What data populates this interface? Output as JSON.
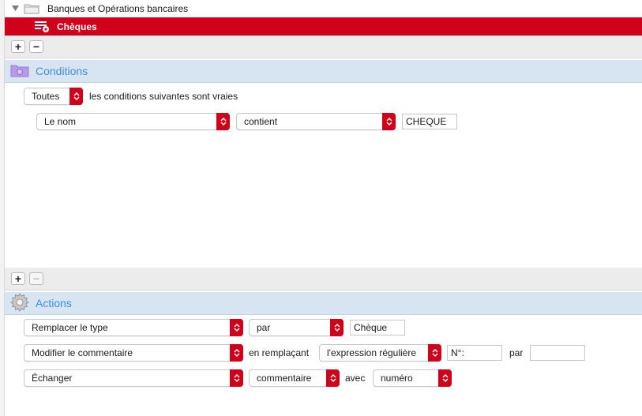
{
  "tree": {
    "parent_label": "Banques et Opérations bancaires",
    "child_label": "Chèques"
  },
  "conditions_bar": {
    "add": "+",
    "remove": "−"
  },
  "conditions": {
    "title": "Conditions",
    "match_select": "Toutes",
    "match_text": "les conditions suivantes sont vraies",
    "rows": [
      {
        "field": "Le nom",
        "operator": "contient",
        "value": "CHEQUE"
      }
    ]
  },
  "actions_bar": {
    "add": "+",
    "remove": "−"
  },
  "actions": {
    "title": "Actions",
    "row1": {
      "action": "Remplacer le type",
      "joiner": "par",
      "value": "Chèque"
    },
    "row2": {
      "action": "Modifier le commentaire",
      "text1": "en remplaçant",
      "mode": "l'expression régulière",
      "pattern": "N°:",
      "text2": "par",
      "replacement": ""
    },
    "row3": {
      "action": "Échanger",
      "field1": "commentaire",
      "text1": "avec",
      "field2": "numéro"
    }
  },
  "colors": {
    "accent": "#d0021b",
    "section_bg": "#d7e5f2",
    "section_title": "#3f8ed8"
  },
  "icons": [
    "disclosure-triangle-icon",
    "folder-icon",
    "list-gear-icon",
    "conditions-folder-icon",
    "actions-gear-icon",
    "stepper-icon"
  ]
}
